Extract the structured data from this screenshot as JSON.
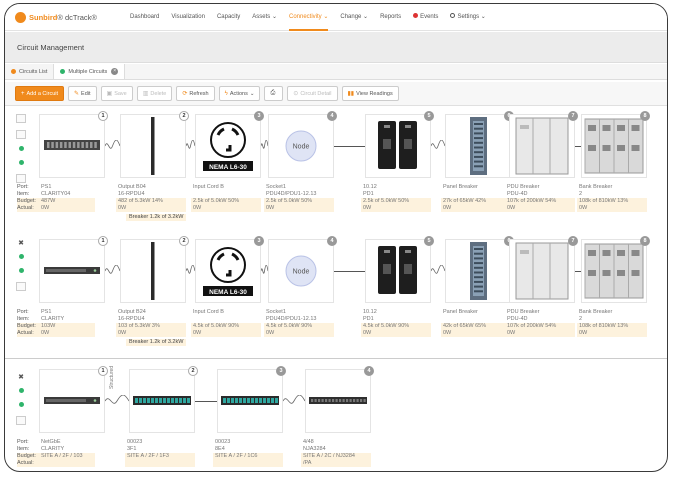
{
  "nav": {
    "logo_brand": "Sunbird",
    "logo_product": "dcTrack",
    "items": [
      {
        "label": "Dashboard",
        "active": false
      },
      {
        "label": "Visualization",
        "active": false
      },
      {
        "label": "Capacity",
        "active": false
      },
      {
        "label": "Assets ⌄",
        "active": false
      },
      {
        "label": "Connectivity ⌄",
        "active": true
      },
      {
        "label": "Change ⌄",
        "active": false
      },
      {
        "label": "Reports",
        "active": false
      },
      {
        "label": "Events",
        "active": false
      },
      {
        "label": "Settings ⌄",
        "active": false
      }
    ]
  },
  "page": {
    "title": "Circuit Management"
  },
  "tabs": [
    {
      "label": "Circuits List",
      "active": false
    },
    {
      "label": "Multiple Circuits",
      "active": true
    }
  ],
  "toolbar": {
    "add": "Add a Circuit",
    "edit": "Edit",
    "save": "Save",
    "delete": "Delete",
    "refresh": "Refresh",
    "actions": "Actions",
    "circuit_detail": "Circuit Detail",
    "view_readings": "View Readings"
  },
  "row_labels": {
    "port": "Port:",
    "item": "Item:",
    "budget": "Budget:",
    "actual": "Actual:"
  },
  "rows": [
    {
      "nodes": [
        {
          "n": "1",
          "kind": "server",
          "port": "PS1",
          "item": "CLARITY04",
          "budget": "487W",
          "actual": "0W"
        },
        {
          "n": "2",
          "kind": "strip",
          "port": "Output B04",
          "item": "16-RPDU4",
          "budget": "482 of 5.3kW  14%",
          "actual": "0W"
        },
        {
          "n": "3",
          "kind": "nema",
          "port": "Input Cord B",
          "item": "",
          "budget": "2.5k of 5.0kW  50%",
          "actual": "0W"
        },
        {
          "n": "4",
          "kind": "nodebubble",
          "port": "Socket1",
          "item": "PDU4D/PDU1-12.13",
          "budget": "2.5k of 5.0kW  50%",
          "actual": "0W"
        },
        {
          "n": "5",
          "kind": "breaker",
          "port": "10.12",
          "item": "PD1",
          "budget": "2.5k of 5.0kW  50%",
          "actual": "0W"
        },
        {
          "n": "6",
          "kind": "panel",
          "port": "Panel Breaker",
          "item": "",
          "budget": "27k of 65kW  42%",
          "actual": "0W"
        },
        {
          "n": "7",
          "kind": "cabinet",
          "port": "PDU Breaker",
          "item": "PDU-4D",
          "budget": "107k of 200kW  54%",
          "actual": "0W"
        },
        {
          "n": "8",
          "kind": "switchgear",
          "port": "Bank Breaker",
          "item": "2",
          "budget": "108k of 810kW  13%",
          "actual": "0W"
        }
      ],
      "breaker_note": "Breaker 1.2k of 3.2kW"
    },
    {
      "nodes": [
        {
          "n": "1",
          "kind": "server2",
          "port": "PS1",
          "item": "CLARITY",
          "budget": "103W",
          "actual": "0W"
        },
        {
          "n": "2",
          "kind": "strip",
          "port": "Output B24",
          "item": "16-RPDU4",
          "budget": "103 of 5.3kW  3%",
          "actual": "0W"
        },
        {
          "n": "3",
          "kind": "nema",
          "port": "Input Cord B",
          "item": "",
          "budget": "4.5k of 5.0kW  90%",
          "actual": "0W"
        },
        {
          "n": "4",
          "kind": "nodebubble",
          "port": "Socket1",
          "item": "PDU4D/PDU1-12.13",
          "budget": "4.5k of 5.0kW  90%",
          "actual": "0W"
        },
        {
          "n": "5",
          "kind": "breaker",
          "port": "10.12",
          "item": "PD1",
          "budget": "4.5k of 5.0kW  90%",
          "actual": "0W"
        },
        {
          "n": "6",
          "kind": "panel",
          "port": "Panel Breaker",
          "item": "",
          "budget": "42k of 65kW  65%",
          "actual": "0W"
        },
        {
          "n": "7",
          "kind": "cabinet",
          "port": "PDU Breaker",
          "item": "PDU-4D",
          "budget": "107k of 200kW  54%",
          "actual": "0W"
        },
        {
          "n": "8",
          "kind": "switchgear",
          "port": "Bank Breaker",
          "item": "2",
          "budget": "108k of 810kW  13%",
          "actual": "0W"
        }
      ],
      "breaker_note": "Breaker 1.2k of 3.2kW"
    },
    {
      "nodes": [
        {
          "n": "1",
          "kind": "server2",
          "port": "NetGbE",
          "item": "CLARITY",
          "budget": "SITE A / 2F / 103",
          "actual": ""
        },
        {
          "n": "2",
          "kind": "patch",
          "port": "00023",
          "item": "3F1",
          "budget": "SITE A / 2F / 1F3",
          "actual": ""
        },
        {
          "n": "3",
          "kind": "patch",
          "port": "00023",
          "item": "8E4",
          "budget": "SITE A / 2F / 1C6",
          "actual": ""
        },
        {
          "n": "4",
          "kind": "switch",
          "port": "4/48",
          "item": "NJA3284",
          "budget": "SITE A / 2C / NJ3284",
          "actual": "/PA"
        }
      ],
      "vertical_label": "Structured"
    }
  ]
}
